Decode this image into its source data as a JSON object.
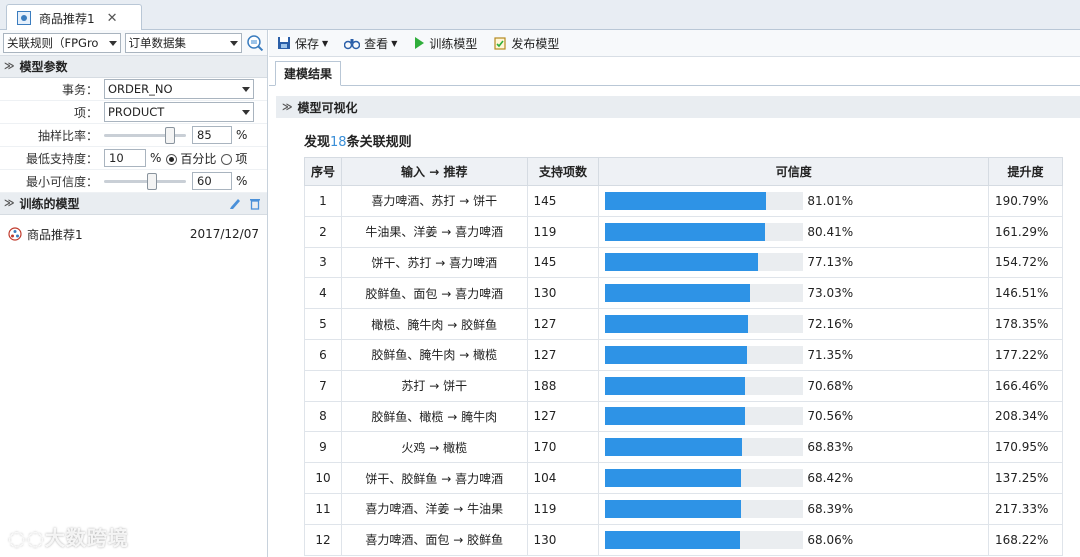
{
  "doc_tab": {
    "label": "商品推荐1",
    "close": "✕"
  },
  "left_toolbar": {
    "algorithm": "关联规则（FPGro",
    "dataset": "订单数据集"
  },
  "params": {
    "section_title": "模型参数",
    "transaction_label": "事务：",
    "transaction_value": "ORDER_NO",
    "item_label": "项：",
    "item_value": "PRODUCT",
    "sampling_label": "抽样比率：",
    "sampling_value": "85",
    "sampling_unit": "%",
    "sampling_fraction": 0.85,
    "support_label": "最低支持度：",
    "support_value": "10",
    "support_unit": "%",
    "support_radio_pct": "百分比",
    "support_radio_item": "项",
    "confidence_label": "最小可信度：",
    "confidence_value": "60",
    "confidence_unit": "%",
    "confidence_fraction": 0.6
  },
  "trained": {
    "section_title": "训练的模型",
    "items": [
      {
        "name": "商品推荐1",
        "date": "2017/12/07"
      }
    ]
  },
  "toolbar": {
    "save": "保存",
    "view": "查看",
    "train": "训练模型",
    "publish": "发布模型"
  },
  "subtab": {
    "label": "建模结果"
  },
  "vis": {
    "title": "模型可视化",
    "found_prefix": "发现",
    "found_count": "18",
    "found_suffix": "条关联规则"
  },
  "table": {
    "headers": [
      "序号",
      "输入 → 推荐",
      "支持项数",
      "可信度",
      "提升度"
    ],
    "rows": [
      {
        "no": "1",
        "rule": "喜力啤酒、苏打 → 饼干",
        "support": "145",
        "conf": "81.01%",
        "conf_v": 81.01,
        "lift": "190.79%"
      },
      {
        "no": "2",
        "rule": "牛油果、洋姜 → 喜力啤酒",
        "support": "119",
        "conf": "80.41%",
        "conf_v": 80.41,
        "lift": "161.29%"
      },
      {
        "no": "3",
        "rule": "饼干、苏打 → 喜力啤酒",
        "support": "145",
        "conf": "77.13%",
        "conf_v": 77.13,
        "lift": "154.72%"
      },
      {
        "no": "4",
        "rule": "胶鲜鱼、面包 → 喜力啤酒",
        "support": "130",
        "conf": "73.03%",
        "conf_v": 73.03,
        "lift": "146.51%"
      },
      {
        "no": "5",
        "rule": "橄榄、腌牛肉 → 胶鲜鱼",
        "support": "127",
        "conf": "72.16%",
        "conf_v": 72.16,
        "lift": "178.35%"
      },
      {
        "no": "6",
        "rule": "胶鲜鱼、腌牛肉 → 橄榄",
        "support": "127",
        "conf": "71.35%",
        "conf_v": 71.35,
        "lift": "177.22%"
      },
      {
        "no": "7",
        "rule": "苏打 → 饼干",
        "support": "188",
        "conf": "70.68%",
        "conf_v": 70.68,
        "lift": "166.46%"
      },
      {
        "no": "8",
        "rule": "胶鲜鱼、橄榄 → 腌牛肉",
        "support": "127",
        "conf": "70.56%",
        "conf_v": 70.56,
        "lift": "208.34%"
      },
      {
        "no": "9",
        "rule": "火鸡 → 橄榄",
        "support": "170",
        "conf": "68.83%",
        "conf_v": 68.83,
        "lift": "170.95%"
      },
      {
        "no": "10",
        "rule": "饼干、胶鲜鱼 → 喜力啤酒",
        "support": "104",
        "conf": "68.42%",
        "conf_v": 68.42,
        "lift": "137.25%"
      },
      {
        "no": "11",
        "rule": "喜力啤酒、洋姜 → 牛油果",
        "support": "119",
        "conf": "68.39%",
        "conf_v": 68.39,
        "lift": "217.33%"
      },
      {
        "no": "12",
        "rule": "喜力啤酒、面包 → 胶鲜鱼",
        "support": "130",
        "conf": "68.06%",
        "conf_v": 68.06,
        "lift": "168.22%"
      }
    ]
  },
  "watermark": "大数跨境",
  "colors": {
    "bar": "#2e93e6",
    "bar_bg": "#eaedf0",
    "count": "#3a8fd8"
  }
}
